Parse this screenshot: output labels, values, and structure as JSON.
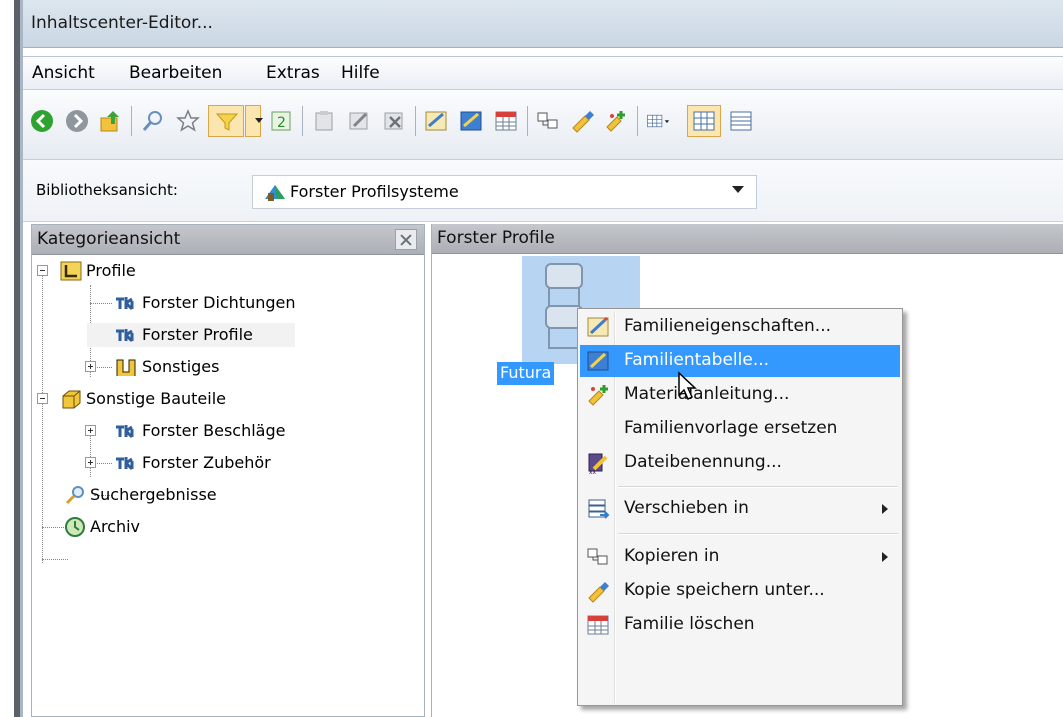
{
  "window": {
    "title": "Inhaltscenter-Editor..."
  },
  "menu": [
    "Ansicht",
    "Bearbeiten",
    "Extras",
    "Hilfe"
  ],
  "library": {
    "label": "Bibliotheksansicht:",
    "value": "Forster Profilsysteme"
  },
  "category_panel": {
    "title": "Kategorieansicht",
    "tree": [
      {
        "label": "Profile",
        "icon": "profile-l-icon"
      },
      {
        "label": "Forster Dichtungen",
        "icon": "profile-family-icon"
      },
      {
        "label": "Forster Profile",
        "icon": "profile-family-icon"
      },
      {
        "label": "Sonstiges",
        "icon": "profile-u-icon"
      },
      {
        "label": "Sonstige Bauteile",
        "icon": "part-box-icon"
      },
      {
        "label": "Forster Beschläge",
        "icon": "profile-family-icon"
      },
      {
        "label": "Forster Zubehör",
        "icon": "profile-family-icon"
      },
      {
        "label": "Suchergebnisse",
        "icon": "search-icon"
      },
      {
        "label": "Archiv",
        "icon": "archive-icon"
      }
    ]
  },
  "family_panel": {
    "title": "Forster Profile",
    "item_label": "Futura"
  },
  "context_menu": [
    {
      "label": "Familieneigenschaften...",
      "icon": "family-properties-icon"
    },
    {
      "label": "Familientabelle...",
      "icon": "family-table-icon",
      "highlighted": true
    },
    {
      "label": "Materialanleitung...",
      "icon": "material-guide-icon"
    },
    {
      "label": "Familienvorlage ersetzen",
      "icon": ""
    },
    {
      "label": "Dateibenennung...",
      "icon": "file-naming-icon"
    },
    {
      "label": "Verschieben in",
      "icon": "move-to-icon",
      "submenu": true
    },
    {
      "label": "Kopieren in",
      "icon": "copy-to-icon",
      "submenu": true
    },
    {
      "label": "Kopie speichern unter...",
      "icon": "save-copy-icon"
    },
    {
      "label": "Familie löschen",
      "icon": "delete-family-icon"
    }
  ],
  "colors": {
    "selection": "#3399ff",
    "thumbnail_selection": "#b7d4f3"
  }
}
